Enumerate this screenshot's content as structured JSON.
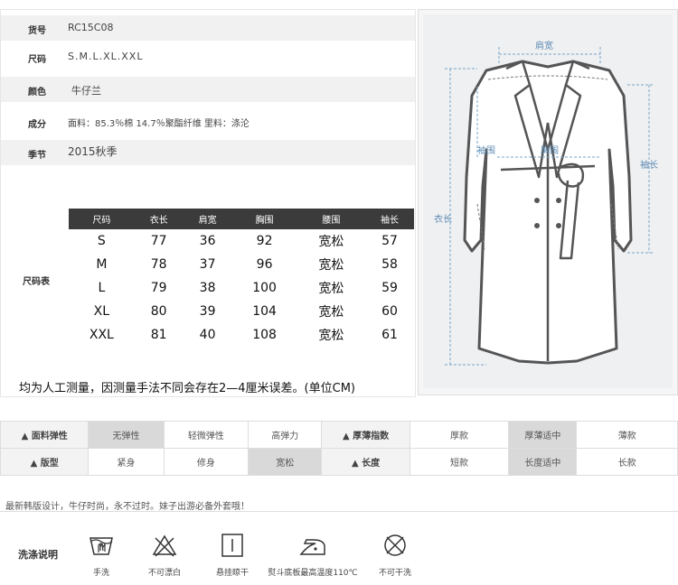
{
  "info": {
    "rows": [
      {
        "label": "货号",
        "value": "RC15C08"
      },
      {
        "label": "尺码",
        "value": "S.M.L.XL.XXL"
      },
      {
        "label": "颜色",
        "value": "牛仔兰"
      },
      {
        "label": "成分",
        "value": "面料：85.3％棉 14.7％聚酯纤维 里料：涤沦"
      },
      {
        "label": "季节",
        "value": "2015秋季"
      }
    ],
    "size_table_label": "尺码表"
  },
  "size_table": {
    "headers": [
      "尺码",
      "衣长",
      "肩宽",
      "胸围",
      "腰围",
      "袖长"
    ],
    "rows": [
      [
        "S",
        "77",
        "36",
        "92",
        "宽松",
        "57"
      ],
      [
        "M",
        "78",
        "37",
        "96",
        "宽松",
        "58"
      ],
      [
        "L",
        "79",
        "38",
        "100",
        "宽松",
        "59"
      ],
      [
        "XL",
        "80",
        "39",
        "104",
        "宽松",
        "60"
      ],
      [
        "XXL",
        "81",
        "40",
        "108",
        "宽松",
        "61"
      ]
    ]
  },
  "note": "均为人工测量，因测量手法不同会存在2—4厘米误差。(单位CM)",
  "diagram": {
    "labels": {
      "shoulder": "肩宽",
      "waist": "袖围",
      "chest": "胸围",
      "length": "衣长",
      "sleeve": "袖长"
    },
    "accent_color": "#7aa6c8"
  },
  "attributes": {
    "row1": {
      "title": "面料弹性",
      "options": [
        "无弹性",
        "轻微弹性",
        "高弹力"
      ],
      "selected": 0,
      "title2": "厚薄指数",
      "options2": [
        "厚款",
        "厚薄适中",
        "薄款"
      ],
      "selected2": 1
    },
    "row2": {
      "title": "版型",
      "options": [
        "紧身",
        "修身",
        "宽松"
      ],
      "selected": 2,
      "title2": "长度",
      "options2": [
        "短款",
        "长度适中",
        "长款"
      ],
      "selected2": 1
    }
  },
  "description": "最新韩版设计，牛仔时尚，永不过时。妹子出游必备外套哦！",
  "care": {
    "title": "洗涤说明",
    "items": [
      {
        "icon": "hand-wash-icon",
        "label": "手洗"
      },
      {
        "icon": "no-bleach-icon",
        "label": "不可漂白"
      },
      {
        "icon": "hang-dry-icon",
        "label": "悬挂晾干"
      },
      {
        "icon": "iron-icon",
        "label": "熨斗底板最高温度110℃"
      },
      {
        "icon": "no-dry-clean-icon",
        "label": "不可干洗"
      }
    ]
  }
}
